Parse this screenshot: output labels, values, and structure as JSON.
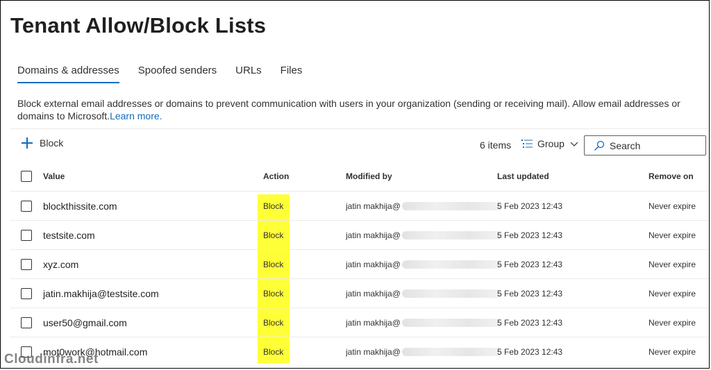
{
  "page": {
    "title": "Tenant Allow/Block Lists",
    "watermark": "Cloudinfra.net"
  },
  "tabs": [
    {
      "label": "Domains & addresses",
      "active": true
    },
    {
      "label": "Spoofed senders",
      "active": false
    },
    {
      "label": "URLs",
      "active": false
    },
    {
      "label": "Files",
      "active": false
    }
  ],
  "description": {
    "text": "Block external email addresses or domains to prevent communication with users in your organization (sending or receiving mail). Allow email addresses or domains to Microsoft.",
    "link": "Learn more."
  },
  "toolbar": {
    "block_label": "Block",
    "items_count": "6 items",
    "group_label": "Group",
    "search_placeholder": "Search"
  },
  "table": {
    "columns": [
      "Value",
      "Action",
      "Modified by",
      "Last updated",
      "Remove on"
    ],
    "rows": [
      {
        "value": "blockthissite.com",
        "action": "Block",
        "modified_by": "jatin makhija@",
        "last_updated": "5 Feb 2023 12:43",
        "remove_on": "Never expire"
      },
      {
        "value": "testsite.com",
        "action": "Block",
        "modified_by": "jatin makhija@",
        "last_updated": "5 Feb 2023 12:43",
        "remove_on": "Never expire"
      },
      {
        "value": "xyz.com",
        "action": "Block",
        "modified_by": "jatin makhija@",
        "last_updated": "5 Feb 2023 12:43",
        "remove_on": "Never expire"
      },
      {
        "value": "jatin.makhija@testsite.com",
        "action": "Block",
        "modified_by": "jatin makhija@",
        "last_updated": "5 Feb 2023 12:43",
        "remove_on": "Never expire"
      },
      {
        "value": "user50@gmail.com",
        "action": "Block",
        "modified_by": "jatin makhija@",
        "last_updated": "5 Feb 2023 12:43",
        "remove_on": "Never expire"
      },
      {
        "value": "mot0work@hotmail.com",
        "action": "Block",
        "modified_by": "jatin makhija@",
        "last_updated": "5 Feb 2023 12:43",
        "remove_on": "Never expire"
      }
    ]
  },
  "colors": {
    "accent": "#0f6cbd",
    "highlight": "#ffff38"
  },
  "icons": {
    "add": "plus-icon",
    "group": "group-list-icon",
    "dropdown": "chevron-down-icon",
    "search": "search-icon"
  }
}
